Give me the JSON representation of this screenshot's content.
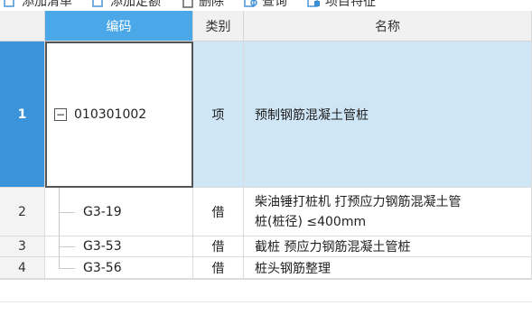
{
  "toolbar": {
    "buttons": [
      {
        "label": "添加清单",
        "icon": "add-list-icon"
      },
      {
        "label": "添加定额",
        "icon": "add-quota-icon"
      },
      {
        "label": "删除",
        "icon": "trash-icon"
      },
      {
        "label": "查询",
        "icon": "search-icon"
      },
      {
        "label": "项目特征",
        "icon": "feature-icon"
      }
    ]
  },
  "table": {
    "headers": {
      "code": "编码",
      "category": "类别",
      "name": "名称"
    },
    "rows": [
      {
        "num": "1",
        "code": "010301002",
        "category": "项",
        "name": "预制钢筋混凝土管桩"
      },
      {
        "num": "2",
        "code": "G3-19",
        "category": "借",
        "name": "柴油锤打桩机 打预应力钢筋混凝土管桩(桩径) ≤400mm",
        "name_line1": "柴油锤打桩机 打预应力钢筋混凝土管",
        "name_line2": "桩(桩径) ≤400mm"
      },
      {
        "num": "3",
        "code": "G3-53",
        "category": "借",
        "name": "截桩 预应力钢筋混凝土管桩"
      },
      {
        "num": "4",
        "code": "G3-56",
        "category": "借",
        "name": "桩头钢筋整理"
      }
    ],
    "expand_symbol": "−"
  },
  "colors": {
    "header_selected": "#4aa8e8",
    "row_selected": "#cfe6f7",
    "rownum_active": "#3b94d9"
  }
}
